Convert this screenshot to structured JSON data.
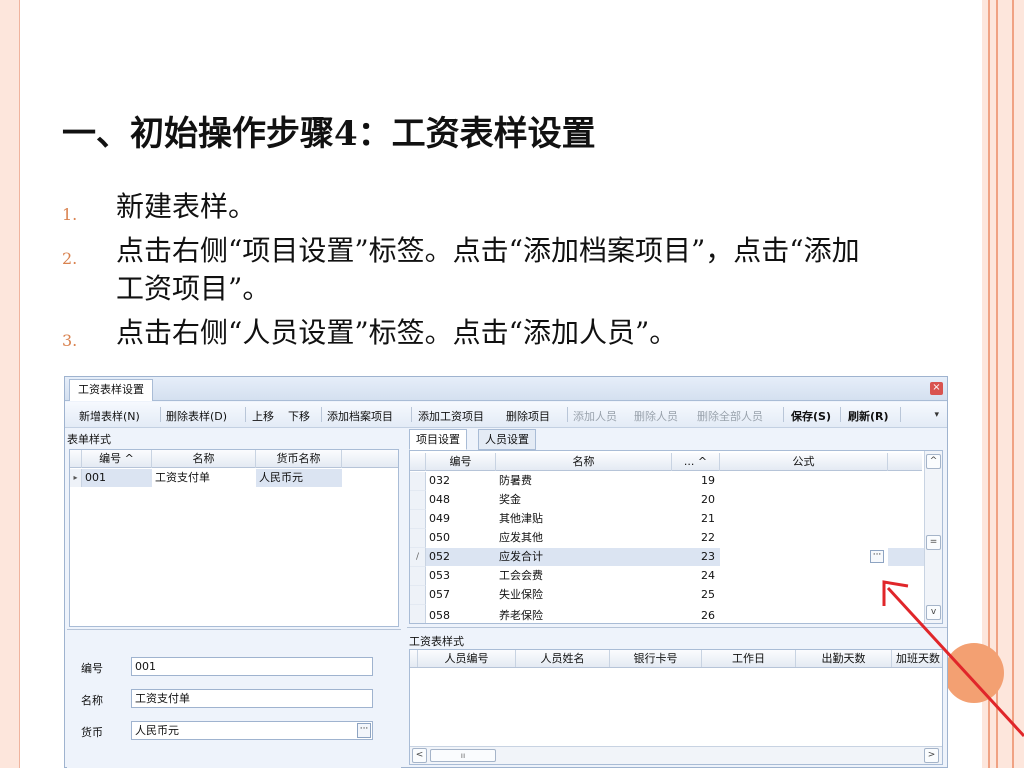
{
  "slide": {
    "title": "一、初始操作步骤4：工资表样设置",
    "bullets": [
      {
        "num": "1.",
        "text": "新建表样。"
      },
      {
        "num": "2.",
        "text": "点击右侧“项目设置”标签。点击“添加档案项目”，点击“添加工资项目”。"
      },
      {
        "num": "3.",
        "text": "点击右侧“人员设置”标签。点击“添加人员”。"
      }
    ]
  },
  "window": {
    "tab_title": "工资表样设置",
    "toolbar": [
      {
        "label": "新增表样(N)",
        "enabled": true
      },
      {
        "label": "删除表样(D)",
        "enabled": true
      },
      {
        "label": "上移",
        "enabled": true
      },
      {
        "label": "下移",
        "enabled": true
      },
      {
        "label": "添加档案项目",
        "enabled": true
      },
      {
        "label": "添加工资项目",
        "enabled": true
      },
      {
        "label": "删除项目",
        "enabled": true
      },
      {
        "label": "添加人员",
        "enabled": false
      },
      {
        "label": "删除人员",
        "enabled": false
      },
      {
        "label": "删除全部人员",
        "enabled": false
      },
      {
        "label": "保存(S)",
        "enabled": true
      },
      {
        "label": "刷新(R)",
        "enabled": true
      }
    ],
    "left": {
      "title": "表单样式",
      "columns": [
        "编号 ^",
        "名称",
        "货币名称"
      ],
      "rows": [
        {
          "no": "001",
          "name": "工资支付单",
          "currency": "人民币元"
        }
      ],
      "form": {
        "no_label": "编号",
        "no_value": "001",
        "name_label": "名称",
        "name_value": "工资支付单",
        "currency_label": "货币",
        "currency_value": "人民币元"
      }
    },
    "right": {
      "tabs": [
        "项目设置",
        "人员设置"
      ],
      "items_columns": [
        "编号",
        "名称",
        "... ^",
        "公式"
      ],
      "items": [
        {
          "no": "032",
          "name": "防暑费",
          "order": "19",
          "formula": ""
        },
        {
          "no": "048",
          "name": "奖金",
          "order": "20",
          "formula": ""
        },
        {
          "no": "049",
          "name": "其他津贴",
          "order": "21",
          "formula": ""
        },
        {
          "no": "050",
          "name": "应发其他",
          "order": "22",
          "formula": ""
        },
        {
          "no": "052",
          "name": "应发合计",
          "order": "23",
          "formula": ""
        },
        {
          "no": "053",
          "name": "工会会费",
          "order": "24",
          "formula": ""
        },
        {
          "no": "057",
          "name": "失业保险",
          "order": "25",
          "formula": ""
        },
        {
          "no": "058",
          "name": "养老保险",
          "order": "26",
          "formula": ""
        }
      ],
      "selected_index": 4,
      "bottom_title": "工资表样式",
      "bottom_columns": [
        "人员编号",
        "人员姓名",
        "银行卡号",
        "工作日",
        "出勤天数",
        "加班天数"
      ]
    },
    "glyphs": {
      "ellipsis": "···",
      "row_pointer": "▸",
      "row_edit": "/",
      "hscroll_thumb": "ıı"
    }
  },
  "colors": {
    "frame": "#fde6dc",
    "frame_line": "#f0a283",
    "accent_dot": "#f3a072",
    "selected_row": "#dbe4f2",
    "arrow": "#e0262a"
  }
}
